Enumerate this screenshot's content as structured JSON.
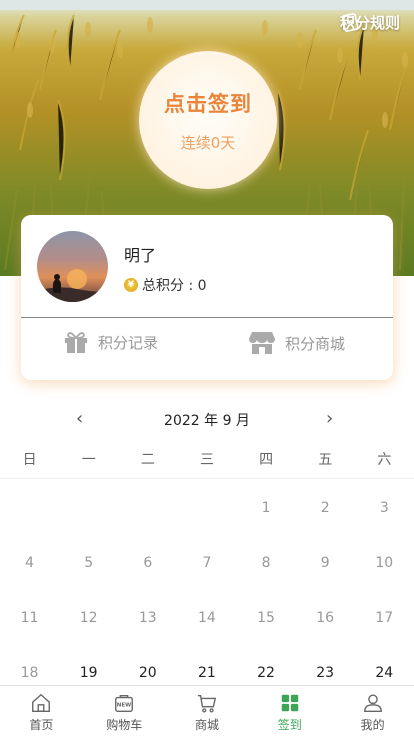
{
  "header": {
    "rules_label": "积分规则"
  },
  "signin": {
    "title": "点击签到",
    "streak": "连续0天"
  },
  "user": {
    "name": "明了",
    "points_label": "总积分 : 0",
    "coin_glyph": "¥"
  },
  "actions": {
    "records_label": "积分记录",
    "mall_label": "积分商城"
  },
  "calendar": {
    "prev": "‹",
    "next": "›",
    "month": "2022 年 9 月",
    "weekdays": [
      "日",
      "一",
      "二",
      "三",
      "四",
      "五",
      "六"
    ],
    "weeks": [
      [
        "",
        "",
        "",
        "",
        "1",
        "2",
        "3"
      ],
      [
        "4",
        "5",
        "6",
        "7",
        "8",
        "9",
        "10"
      ],
      [
        "11",
        "12",
        "13",
        "14",
        "15",
        "16",
        "17"
      ],
      [
        "18",
        "19",
        "20",
        "21",
        "22",
        "23",
        "24"
      ]
    ]
  },
  "tabbar": {
    "home": "首页",
    "cart": "购物车",
    "mall": "商城",
    "checkin": "签到",
    "mine": "我的"
  },
  "colors": {
    "accent": "#e9843a",
    "active_tab": "#3da557"
  }
}
